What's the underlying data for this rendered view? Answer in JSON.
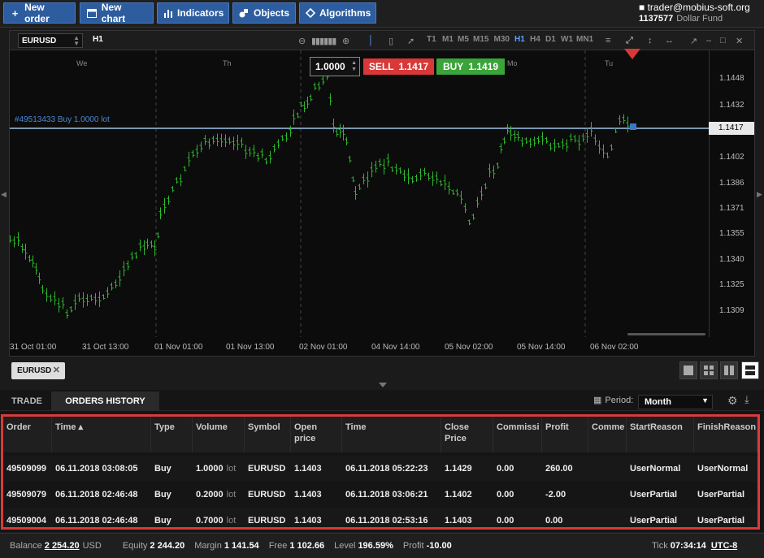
{
  "toolbar": {
    "buttons": [
      {
        "icon": "plus-icon",
        "label": "New order"
      },
      {
        "icon": "chart-window-icon",
        "label": "New chart"
      },
      {
        "icon": "bar-chart-icon",
        "label": "Indicators"
      },
      {
        "icon": "shapes-icon",
        "label": "Objects"
      },
      {
        "icon": "diamond-icon",
        "label": "Algorithms"
      }
    ]
  },
  "account": {
    "user": "trader@mobius-soft.org",
    "number": "1137577",
    "name": "Dollar Fund",
    "icon": "user-icon"
  },
  "chart": {
    "symbol": "EURUSD",
    "timeframe": "H1",
    "periods": [
      "T1",
      "M1",
      "M5",
      "M15",
      "M30",
      "H1",
      "H4",
      "D1",
      "W1",
      "MN1"
    ],
    "active_period": "H1",
    "quantity": "1.0000",
    "sell_label": "SELL",
    "sell_price": "1.1417",
    "buy_label": "BUY",
    "buy_price": "1.1419",
    "position_label": "#49513433 Buy 1.0000 lot",
    "current_price": "1.1417",
    "y_ticks": [
      "1.1448",
      "1.1432",
      "1.1417",
      "1.1402",
      "1.1386",
      "1.1371",
      "1.1355",
      "1.1340",
      "1.1325",
      "1.1309"
    ],
    "x_labels": [
      "31 Oct 01:00",
      "31 Oct 13:00",
      "01 Nov 01:00",
      "01 Nov 13:00",
      "02 Nov 01:00",
      "04 Nov 14:00",
      "05 Nov 02:00",
      "05 Nov 14:00",
      "06 Nov 02:00"
    ],
    "day_labels": [
      "We",
      "Th",
      "Mo",
      "Tu"
    ],
    "candle_color": "#2db82d",
    "sell_color": "#d93838",
    "buy_color": "#3aa33a"
  },
  "tabs": {
    "symbol_tab": "EURUSD"
  },
  "panel": {
    "tabs": [
      "TRADE",
      "ORDERS HISTORY"
    ],
    "active_tab": "ORDERS HISTORY",
    "period_label": "Period:",
    "period_value": "Month",
    "columns": [
      "Order",
      "Time",
      "Type",
      "Volume",
      "Symbol",
      "Open price",
      "Time",
      "Close Price",
      "Commissi",
      "Profit",
      "Comme",
      "StartReason",
      "FinishReason"
    ],
    "rows": [
      {
        "order": "49509099",
        "time": "06.11.2018 03:08:05",
        "type": "Buy",
        "volume": "1.0000",
        "unit": "lot",
        "symbol": "EURUSD",
        "open_price": "1.1403",
        "close_time": "06.11.2018 05:22:23",
        "close_price": "1.1429",
        "commission": "0.00",
        "profit": "260.00",
        "comment": "",
        "start_reason": "UserNormal",
        "finish_reason": "UserNormal"
      },
      {
        "order": "49509079",
        "time": "06.11.2018 02:46:48",
        "type": "Buy",
        "volume": "0.2000",
        "unit": "lot",
        "symbol": "EURUSD",
        "open_price": "1.1403",
        "close_time": "06.11.2018 03:06:21",
        "close_price": "1.1402",
        "commission": "0.00",
        "profit": "-2.00",
        "comment": "",
        "start_reason": "UserPartial",
        "finish_reason": "UserPartial"
      },
      {
        "order": "49509004",
        "time": "06.11.2018 02:46:48",
        "type": "Buy",
        "volume": "0.7000",
        "unit": "lot",
        "symbol": "EURUSD",
        "open_price": "1.1403",
        "close_time": "06.11.2018 02:53:16",
        "close_price": "1.1403",
        "commission": "0.00",
        "profit": "0.00",
        "comment": "",
        "start_reason": "UserPartial",
        "finish_reason": "UserPartial"
      }
    ]
  },
  "status": {
    "balance_label": "Balance",
    "balance": "2 254.20",
    "currency": "USD",
    "equity_label": "Equity",
    "equity": "2 244.20",
    "margin_label": "Margin",
    "margin": "1 141.54",
    "free_label": "Free",
    "free": "1 102.66",
    "level_label": "Level",
    "level": "196.59%",
    "profit_label": "Profit",
    "profit": "-10.00",
    "tick_label": "Tick",
    "tick": "07:34:14",
    "timezone": "UTC-8"
  }
}
